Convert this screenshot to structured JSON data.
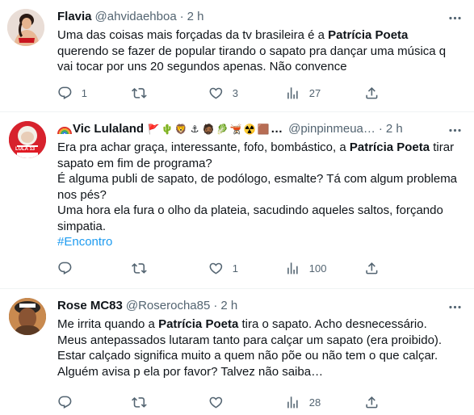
{
  "tweets": [
    {
      "name": "Flavia",
      "handle": "@ahvidaehboa",
      "dot": "·",
      "time": "2 h",
      "text_parts": [
        "Uma das coisas mais forçadas da tv brasileira é a ",
        "Patrícia Poeta",
        " querendo se fazer de popular tirando o sapato pra dançar uma música q vai tocar por uns 20 segundos apenas. Não convence"
      ],
      "replies": "1",
      "retweets": "",
      "likes": "3",
      "views": "27"
    },
    {
      "name": "Vic Lulaland",
      "name_emojis": [
        "🚩",
        "🌵",
        "🦁",
        "⚓",
        "🧔🏾",
        "🥬",
        "🫕",
        "☢️",
        "🟫"
      ],
      "name_ellipsis": "…",
      "avatar_badge": "LULA 13",
      "handle": "@pinpinmeua…",
      "dot": "·",
      "time": "2 h",
      "text_parts": [
        "Era pra achar graça, interessante, fofo, bombástico, a ",
        "Patrícia Poeta",
        " tirar sapato em fim de programa?",
        "É alguma publi de sapato, de podólogo, esmalte? Tá com algum problema nos pés?",
        "Uma hora ela fura o olho da plateia, sacudindo aqueles saltos, forçando simpatia."
      ],
      "hashtag": "#Encontro",
      "replies": "",
      "retweets": "",
      "likes": "1",
      "views": "100"
    },
    {
      "name": "Rose MC83",
      "handle": "@Roserocha85",
      "dot": "·",
      "time": "2 h",
      "text_parts": [
        "Me irrita quando a ",
        "Patrícia Poeta",
        " tira o sapato. Acho desnecessário.",
        "Meus antepassados lutaram tanto para calçar um sapato (era proibido).",
        "Estar calçado significa muito a quem não põe ou não tem o que calçar.",
        "Alguém avisa p ela por favor? Talvez não saiba…"
      ],
      "replies": "",
      "retweets": "",
      "likes": "",
      "views": "28"
    }
  ],
  "colors": {
    "text": "#0f1419",
    "secondary": "#536471",
    "link": "#1d9bf0",
    "divider": "#eff3f4"
  },
  "icons": [
    "more-icon",
    "reply-icon",
    "retweet-icon",
    "like-icon",
    "views-icon",
    "share-icon"
  ]
}
